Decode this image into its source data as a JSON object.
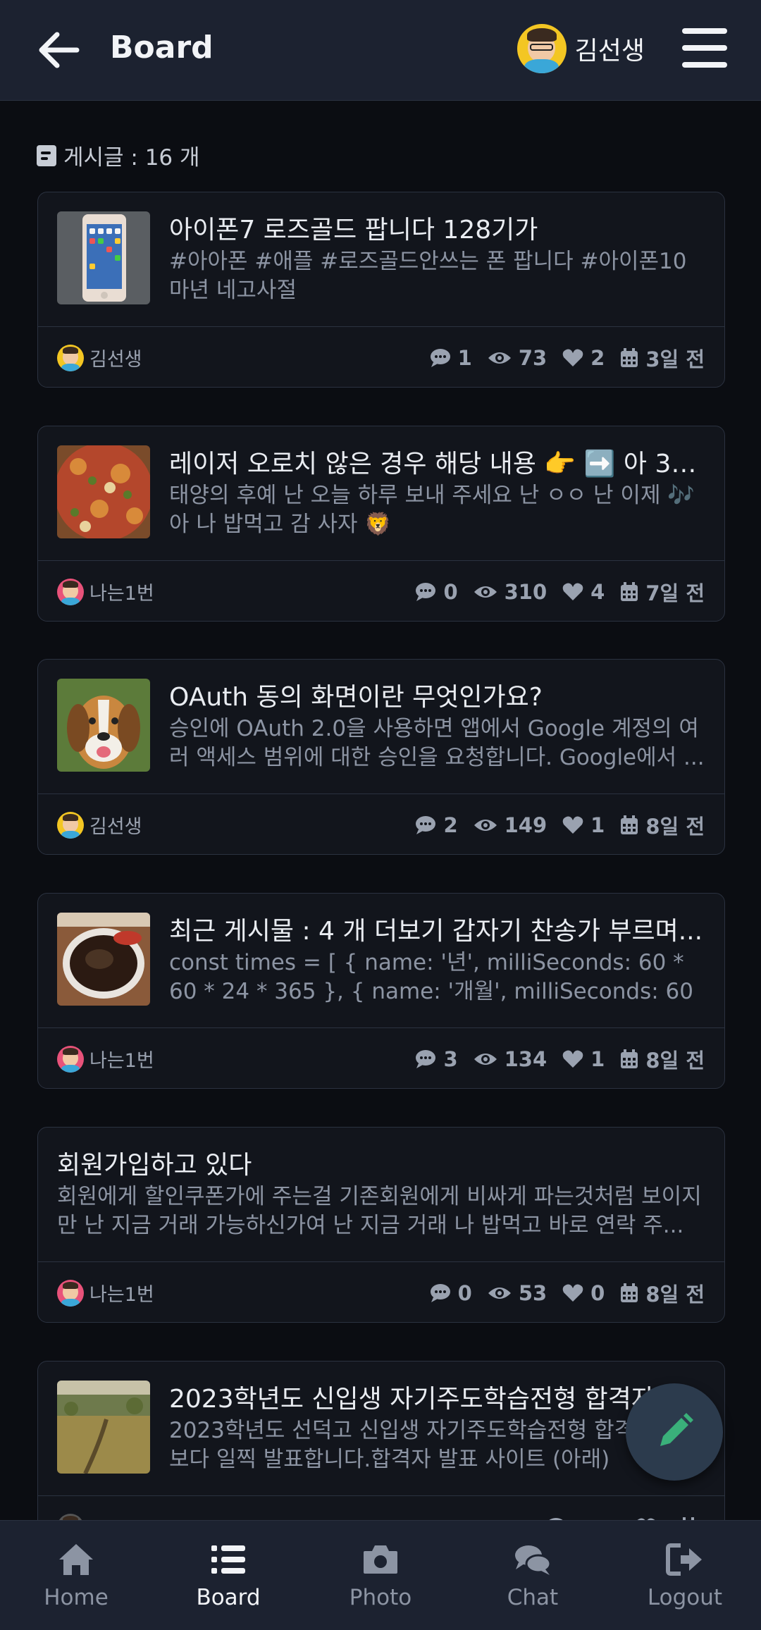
{
  "header": {
    "title": "Board",
    "user_name": "김선생"
  },
  "board": {
    "count_label": "게시글 : 16 개"
  },
  "posts": [
    {
      "title": "아이폰7 로즈골드 팝니다 128기가",
      "excerpt": "#아아폰 #애플 #로즈골드안쓰는 폰 팝니다 #아이폰10마년 네고사절",
      "thumb": "phone",
      "author": "김선생",
      "avatar_color": "#f3c623",
      "comments": "1",
      "views": "73",
      "likes": "2",
      "date": "3일 전"
    },
    {
      "title": "레이저 오로치 않은 경우 해당 내용 👉 ➡️ 아 33...",
      "excerpt": "태양의 후예 난 오늘 하루 보내 주세요 난 ㅇㅇ 난 이제 🎶 아 나 밥먹고 감 사자 🦁",
      "thumb": "pizza",
      "author": "나는1번",
      "avatar_color": "#e8527a",
      "comments": "0",
      "views": "310",
      "likes": "4",
      "date": "7일 전"
    },
    {
      "title": "OAuth 동의 화면이란 무엇인가요?",
      "excerpt": "승인에 OAuth 2.0을 사용하면 앱에서 Google 계정의 여러 액세스 범위에 대한 승인을 요청합니다. Google에서 ...",
      "thumb": "dog",
      "author": "김선생",
      "avatar_color": "#f3c623",
      "comments": "2",
      "views": "149",
      "likes": "1",
      "date": "8일 전"
    },
    {
      "title": "최근 게시물 : 4 개 더보기 갑자기 찬송가 부르며...",
      "excerpt": "const times = [    { name: '년', milliSeconds: 60 * 60 * 24 * 365 },    { name: '개월', milliSeconds: 60 * ...",
      "thumb": "coffee",
      "author": "나는1번",
      "avatar_color": "#e8527a",
      "comments": "3",
      "views": "134",
      "likes": "1",
      "date": "8일 전"
    },
    {
      "title": "회원가입하고 있다",
      "excerpt": "회원에게 할인쿠폰가에 주는걸 기존회원에게 비싸게 파는것처럼 보이지만 난 지금 거래 가능하신가여 난 지금 거래 나 밥먹고 바로 연락 주...",
      "thumb": "",
      "author": "나는1번",
      "avatar_color": "#e8527a",
      "comments": "0",
      "views": "53",
      "likes": "0",
      "date": "8일 전"
    },
    {
      "title": "2023학년도 신입생 자기주도학습전형 합격자",
      "excerpt": "2023학년도 선덕고 신입생 자기주도학습전형 합격자 예정보다 일찍 발표합니다.합격자 발표 사이트 (아래)",
      "thumb": "field",
      "author": "",
      "avatar_color": "#555555",
      "comments": "",
      "views": "",
      "likes": "",
      "date": ""
    }
  ],
  "bottom_nav": [
    {
      "label": "Home",
      "icon": "home-icon"
    },
    {
      "label": "Board",
      "icon": "list-icon"
    },
    {
      "label": "Photo",
      "icon": "camera-icon"
    },
    {
      "label": "Chat",
      "icon": "chat-icon"
    },
    {
      "label": "Logout",
      "icon": "logout-icon"
    }
  ],
  "colors": {
    "background": "#0b0d12",
    "header": "#1c2230",
    "card": "#12151c",
    "fab": "#2c3b4d",
    "fab_icon": "#3ab07a"
  }
}
